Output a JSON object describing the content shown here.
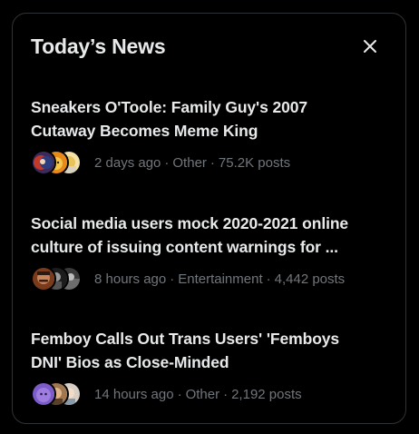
{
  "panel": {
    "title": "Today’s News",
    "close_icon": "close-icon"
  },
  "news": [
    {
      "headline_line1": "Sneakers O'Toole: Family Guy's 2007",
      "headline_line2": "Cutaway Becomes Meme King",
      "time": "2 days ago",
      "category": "Other",
      "posts": "75.2K posts",
      "avatars": [
        "avatar-red-blue",
        "avatar-orange-face",
        "avatar-yellow-face"
      ]
    },
    {
      "headline_line1": "Social media users mock 2020-2021 online",
      "headline_line2": "culture of issuing content warnings for ...",
      "time": "8 hours ago",
      "category": "Entertainment",
      "posts": "4,442 posts",
      "avatars": [
        "avatar-mustache-man",
        "avatar-dark-figure",
        "avatar-gray-scene"
      ]
    },
    {
      "headline_line1": "Femboy Calls Out Trans Users' 'Femboys",
      "headline_line2": "DNI' Bios as Close-Minded",
      "time": "14 hours ago",
      "category": "Other",
      "posts": "2,192 posts",
      "avatars": [
        "avatar-purple-character",
        "avatar-tan-portrait",
        "avatar-light-portrait"
      ]
    }
  ],
  "separator": "·",
  "colors": {
    "background": "#000000",
    "border": "#2f3336",
    "primary_text": "#e7e9ea",
    "secondary_text": "#71767b"
  }
}
